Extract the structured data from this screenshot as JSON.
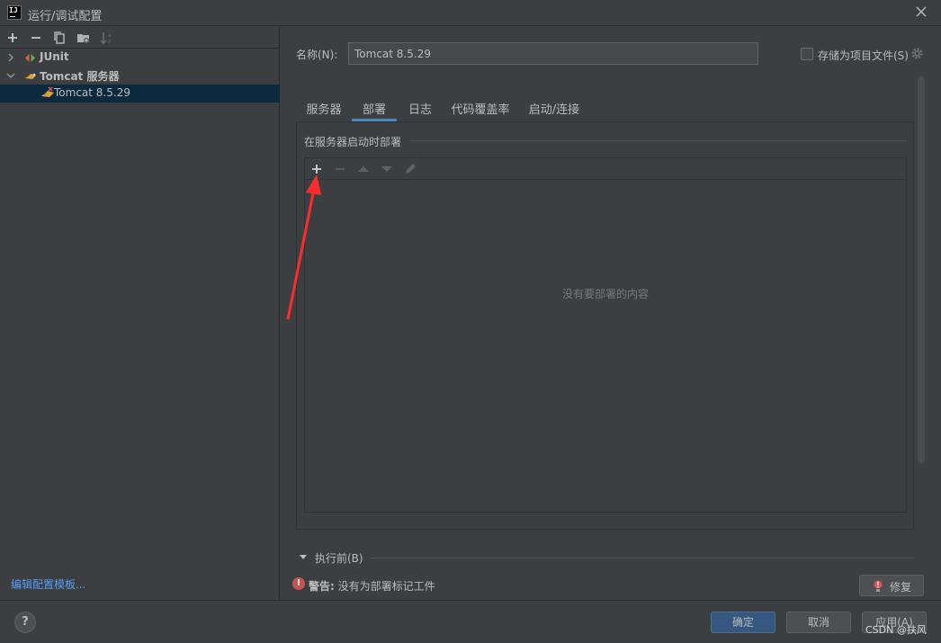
{
  "window": {
    "title": "运行/调试配置"
  },
  "left_toolbar": {
    "icons": [
      "add-icon",
      "remove-icon",
      "copy-icon",
      "folder-add-icon",
      "sort-icon"
    ]
  },
  "tree": {
    "items": [
      {
        "label": "JUnit",
        "expanded": false,
        "bold": true,
        "icon": "junit-icon"
      },
      {
        "label": "Tomcat 服务器",
        "expanded": true,
        "bold": true,
        "icon": "tomcat-icon"
      },
      {
        "label": "Tomcat 8.5.29",
        "selected": true,
        "icon": "tomcat-icon"
      }
    ]
  },
  "edit_templates_link": "编辑配置模板...",
  "name_field": {
    "label": "名称(N):",
    "value": "Tomcat 8.5.29"
  },
  "store_as_project_file": {
    "label": "存储为项目文件(S)",
    "checked": false
  },
  "tabs": [
    {
      "label": "服务器",
      "active": false
    },
    {
      "label": "部署",
      "active": true
    },
    {
      "label": "日志",
      "active": false
    },
    {
      "label": "代码覆盖率",
      "active": false
    },
    {
      "label": "启动/连接",
      "active": false
    }
  ],
  "deployment": {
    "section_title": "在服务器启动时部署",
    "toolbar_icons": [
      "add-icon",
      "remove-icon",
      "move-up-icon",
      "move-down-icon",
      "edit-icon"
    ],
    "empty_text": "没有要部署的内容"
  },
  "before_launch": {
    "label": "执行前(B)"
  },
  "warning": {
    "prefix": "警告:",
    "message": "没有为部署标记工件"
  },
  "fix_button": "修复",
  "buttons": {
    "ok": "确定",
    "cancel": "取消",
    "apply": "应用(A)",
    "help": "?"
  },
  "watermark": "CSDN @扶风",
  "colors": {
    "background": "#3c3f41",
    "selection": "#0d293e",
    "accent": "#4a88c7",
    "primary_button": "#365880",
    "link": "#589df6",
    "error": "#c75450",
    "annotation_arrow": "#ff2b2b"
  }
}
